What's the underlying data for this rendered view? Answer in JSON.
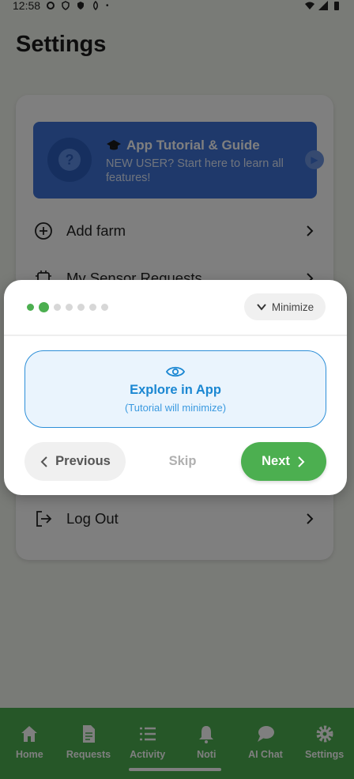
{
  "status_bar": {
    "time": "12:58"
  },
  "page": {
    "title": "Settings"
  },
  "tutorial_banner": {
    "title": "App Tutorial & Guide",
    "subtitle": "NEW USER? Start here to learn all features!"
  },
  "menu": {
    "items": [
      {
        "label": "Add farm",
        "icon": "add-circle-icon"
      },
      {
        "label": "My Sensor Requests",
        "icon": "chip-icon"
      },
      {
        "label": "Log Out",
        "icon": "logout-icon"
      }
    ]
  },
  "bottom_nav": {
    "items": [
      {
        "label": "Home",
        "icon": "home-icon"
      },
      {
        "label": "Requests",
        "icon": "document-icon"
      },
      {
        "label": "Activity",
        "icon": "list-icon"
      },
      {
        "label": "Noti",
        "icon": "bell-icon"
      },
      {
        "label": "AI Chat",
        "icon": "chat-icon"
      },
      {
        "label": "Settings",
        "icon": "gear-icon"
      }
    ]
  },
  "tutorial_modal": {
    "progress": {
      "total_steps": 7,
      "current_step": 2
    },
    "minimize_label": "Minimize",
    "explore_title": "Explore in App",
    "explore_subtitle": "(Tutorial will minimize)",
    "previous_label": "Previous",
    "skip_label": "Skip",
    "next_label": "Next"
  },
  "colors": {
    "primary_green": "#4caf50",
    "banner_blue": "#3f73d6",
    "explore_blue": "#1b87d2",
    "overlay": "rgba(0,0,0,0.5)"
  }
}
